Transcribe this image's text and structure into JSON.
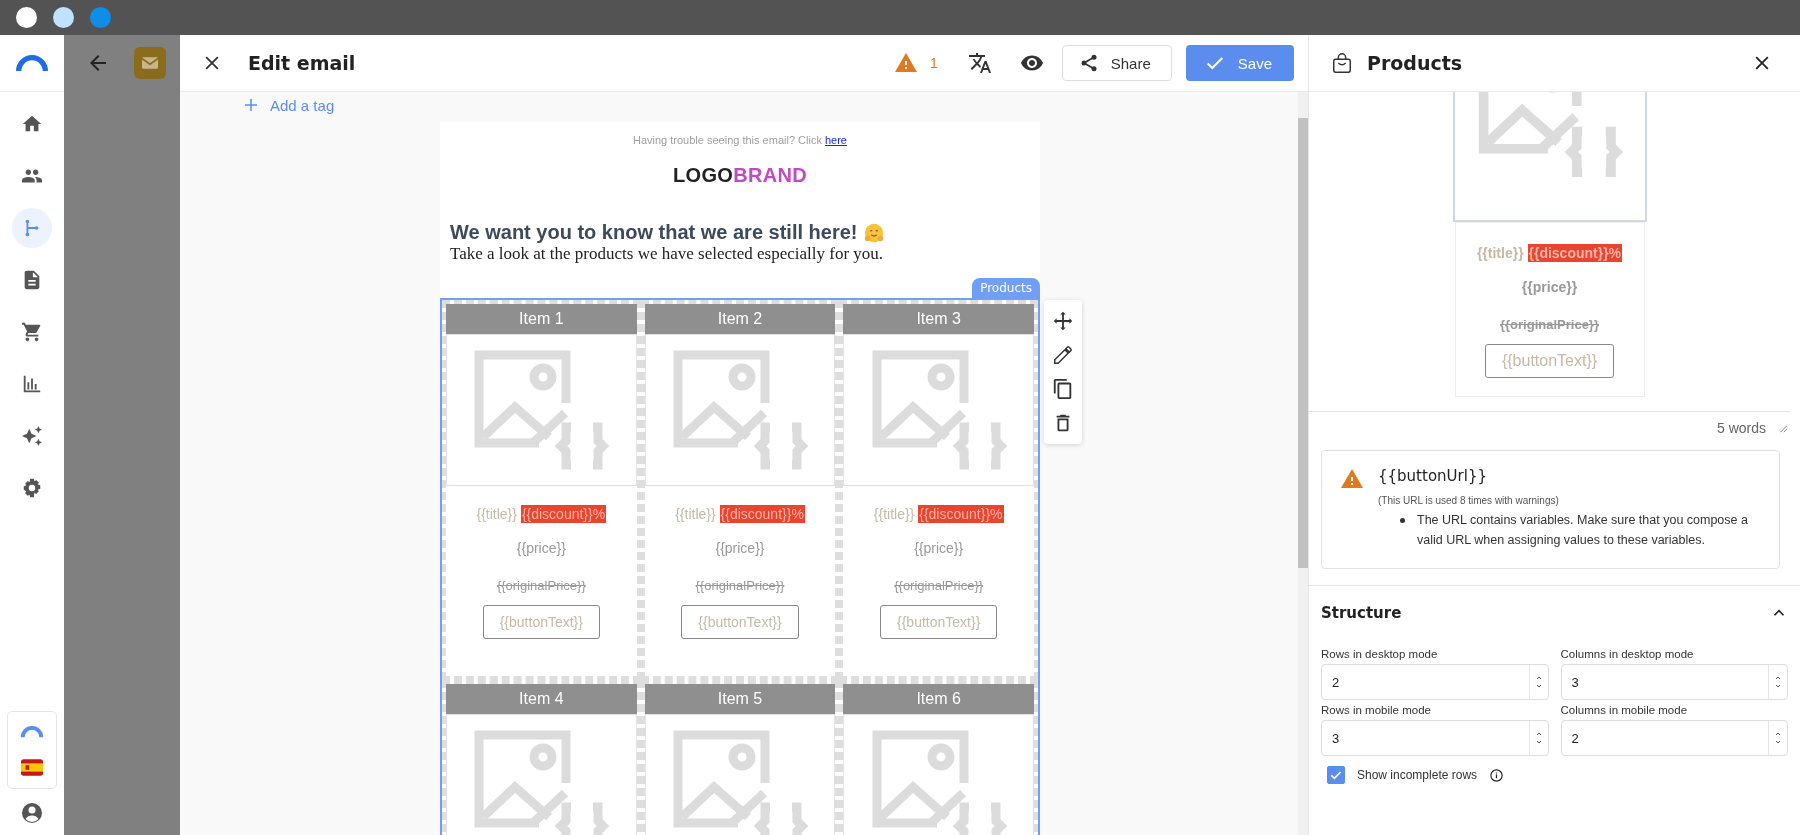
{
  "nav": {
    "items": [
      {
        "kind": "home",
        "selected": false
      },
      {
        "kind": "contacts",
        "selected": false
      },
      {
        "kind": "automation",
        "selected": true
      },
      {
        "kind": "document",
        "selected": false
      },
      {
        "kind": "cart",
        "selected": false
      },
      {
        "kind": "chart",
        "selected": false
      },
      {
        "kind": "sparkle",
        "selected": false
      },
      {
        "kind": "settings",
        "selected": false
      }
    ]
  },
  "editor": {
    "title": "Edit email",
    "warning_count": "1",
    "share": "Share",
    "save": "Save",
    "add_tag": "Add a tag"
  },
  "email": {
    "notice": "Having trouble seeing this email? Click",
    "notice_link": "here",
    "logo_dark": "LOGO",
    "logo_accent": "BRAND",
    "heading": "We want you to know that we are still here!",
    "subheading": "Take a look at the products we have selected especially for you.",
    "block_tag": "Products",
    "items": [
      {
        "label": "Item 1",
        "title": "{{title}}",
        "discount": "{{discount}}%",
        "price": "{{price}}",
        "original_price": "{{originalPrice}}",
        "button": "{{buttonText}}"
      },
      {
        "label": "Item 2",
        "title": "{{title}}",
        "discount": "{{discount}}%",
        "price": "{{price}}",
        "original_price": "{{originalPrice}}",
        "button": "{{buttonText}}"
      },
      {
        "label": "Item 3",
        "title": "{{title}}",
        "discount": "{{discount}}%",
        "price": "{{price}}",
        "original_price": "{{originalPrice}}",
        "button": "{{buttonText}}"
      },
      {
        "label": "Item 4"
      },
      {
        "label": "Item 5"
      },
      {
        "label": "Item 6"
      }
    ]
  },
  "panel": {
    "title": "Products",
    "preview": {
      "title": "{{title}}",
      "discount": "{{discount}}%",
      "price": "{{price}}",
      "original_price": "{{originalPrice}}",
      "button": "{{buttonText}}"
    },
    "word_count": "5 words",
    "warning": {
      "title": "{{buttonUrl}}",
      "note": "(This URL is used 8 times with warnings)",
      "messages": [
        "The URL contains variables. Make sure that you compose a valid URL when assigning values to these variables."
      ]
    },
    "structure": {
      "title": "Structure",
      "expanded": true,
      "fields": [
        {
          "label": "Rows in desktop mode",
          "value": "2"
        },
        {
          "label": "Columns in desktop mode",
          "value": "3"
        },
        {
          "label": "Rows in mobile mode",
          "value": "3"
        },
        {
          "label": "Columns in mobile mode",
          "value": "2"
        }
      ],
      "show_incomplete": {
        "label": "Show incomplete rows",
        "checked": true
      }
    }
  }
}
